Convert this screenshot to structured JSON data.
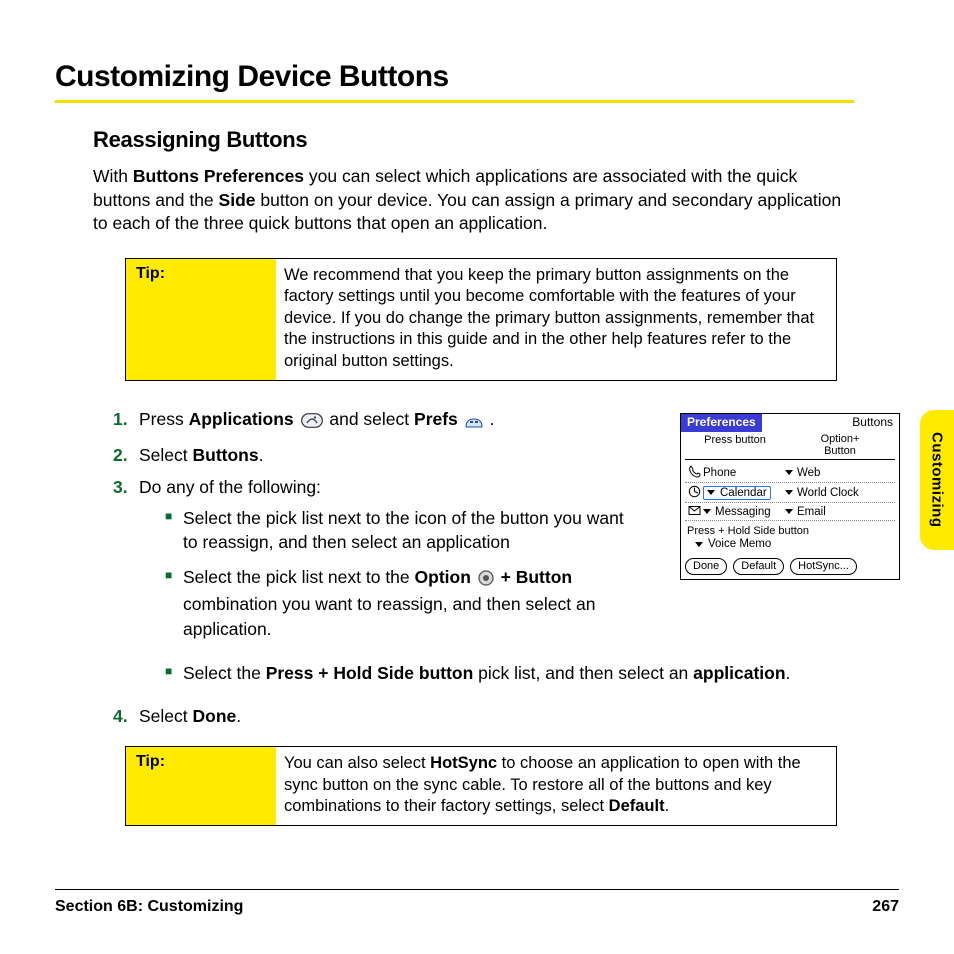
{
  "heading": "Customizing Device Buttons",
  "subheading": "Reassigning Buttons",
  "intro_parts": {
    "p1": "With ",
    "b1": "Buttons Preferences",
    "p2": " you can select which applications are associated with the quick buttons and the ",
    "b2": "Side",
    "p3": " button on your device. You can assign a primary and secondary application to each of the three quick buttons that open an application."
  },
  "tip1": {
    "label": "Tip:",
    "body": "We recommend that you keep the primary button assignments on the factory settings until you become comfortable with the features of your device. If you do change the primary button assignments, remember that the instructions in this guide and in the other help features refer to the original button settings."
  },
  "steps": {
    "s1": {
      "num": "1.",
      "a": "Press ",
      "b1": "Applications",
      "b": " and select ",
      "b2": "Prefs",
      "c": " ."
    },
    "s2": {
      "num": "2.",
      "a": "Select ",
      "b1": "Buttons",
      "b": "."
    },
    "s3": {
      "num": "3.",
      "a": "Do any of the following:"
    },
    "s4": {
      "num": "4.",
      "a": "Select ",
      "b1": "Done",
      "b": "."
    }
  },
  "bullets": {
    "b1": "Select the pick list next to the icon of the button you want to reassign, and then select an application",
    "b2": {
      "a": "Select the pick list next to the ",
      "b1": "Option",
      "mid": " ",
      "b2": "+ Button",
      "b": " combination you want to reassign, and then select an application."
    },
    "b3": {
      "a": "Select the ",
      "b1": "Press + Hold Side button",
      "b": " pick list, and then select an ",
      "b2": "application",
      "c": "."
    }
  },
  "tip2": {
    "label": "Tip:",
    "a": "You can also select ",
    "b1": "HotSync",
    "b": " to choose an application to open with the sync button on the sync cable. To restore all of the buttons and key combinations to their factory settings, select ",
    "b2": "Default",
    "c": "."
  },
  "side_tab": "Customizing",
  "footer": {
    "section": "Section 6B: Customizing",
    "page": "267"
  },
  "palm": {
    "title_left": "Preferences",
    "title_right": "Buttons",
    "col1": "Press button",
    "col2a": "Option+",
    "col2b": "Button",
    "rows": [
      {
        "icon": "phone-icon",
        "label1": "Phone",
        "label2": "Web"
      },
      {
        "icon": "calendar-icon",
        "label1": "Calendar",
        "label2": "World Clock",
        "selected": true
      },
      {
        "icon": "mail-icon",
        "label1": "Messaging",
        "label2": "Email"
      }
    ],
    "side_label": "Press + Hold Side button",
    "side_value": "Voice Memo",
    "buttons": {
      "done": "Done",
      "default": "Default",
      "hotsync": "HotSync..."
    }
  }
}
